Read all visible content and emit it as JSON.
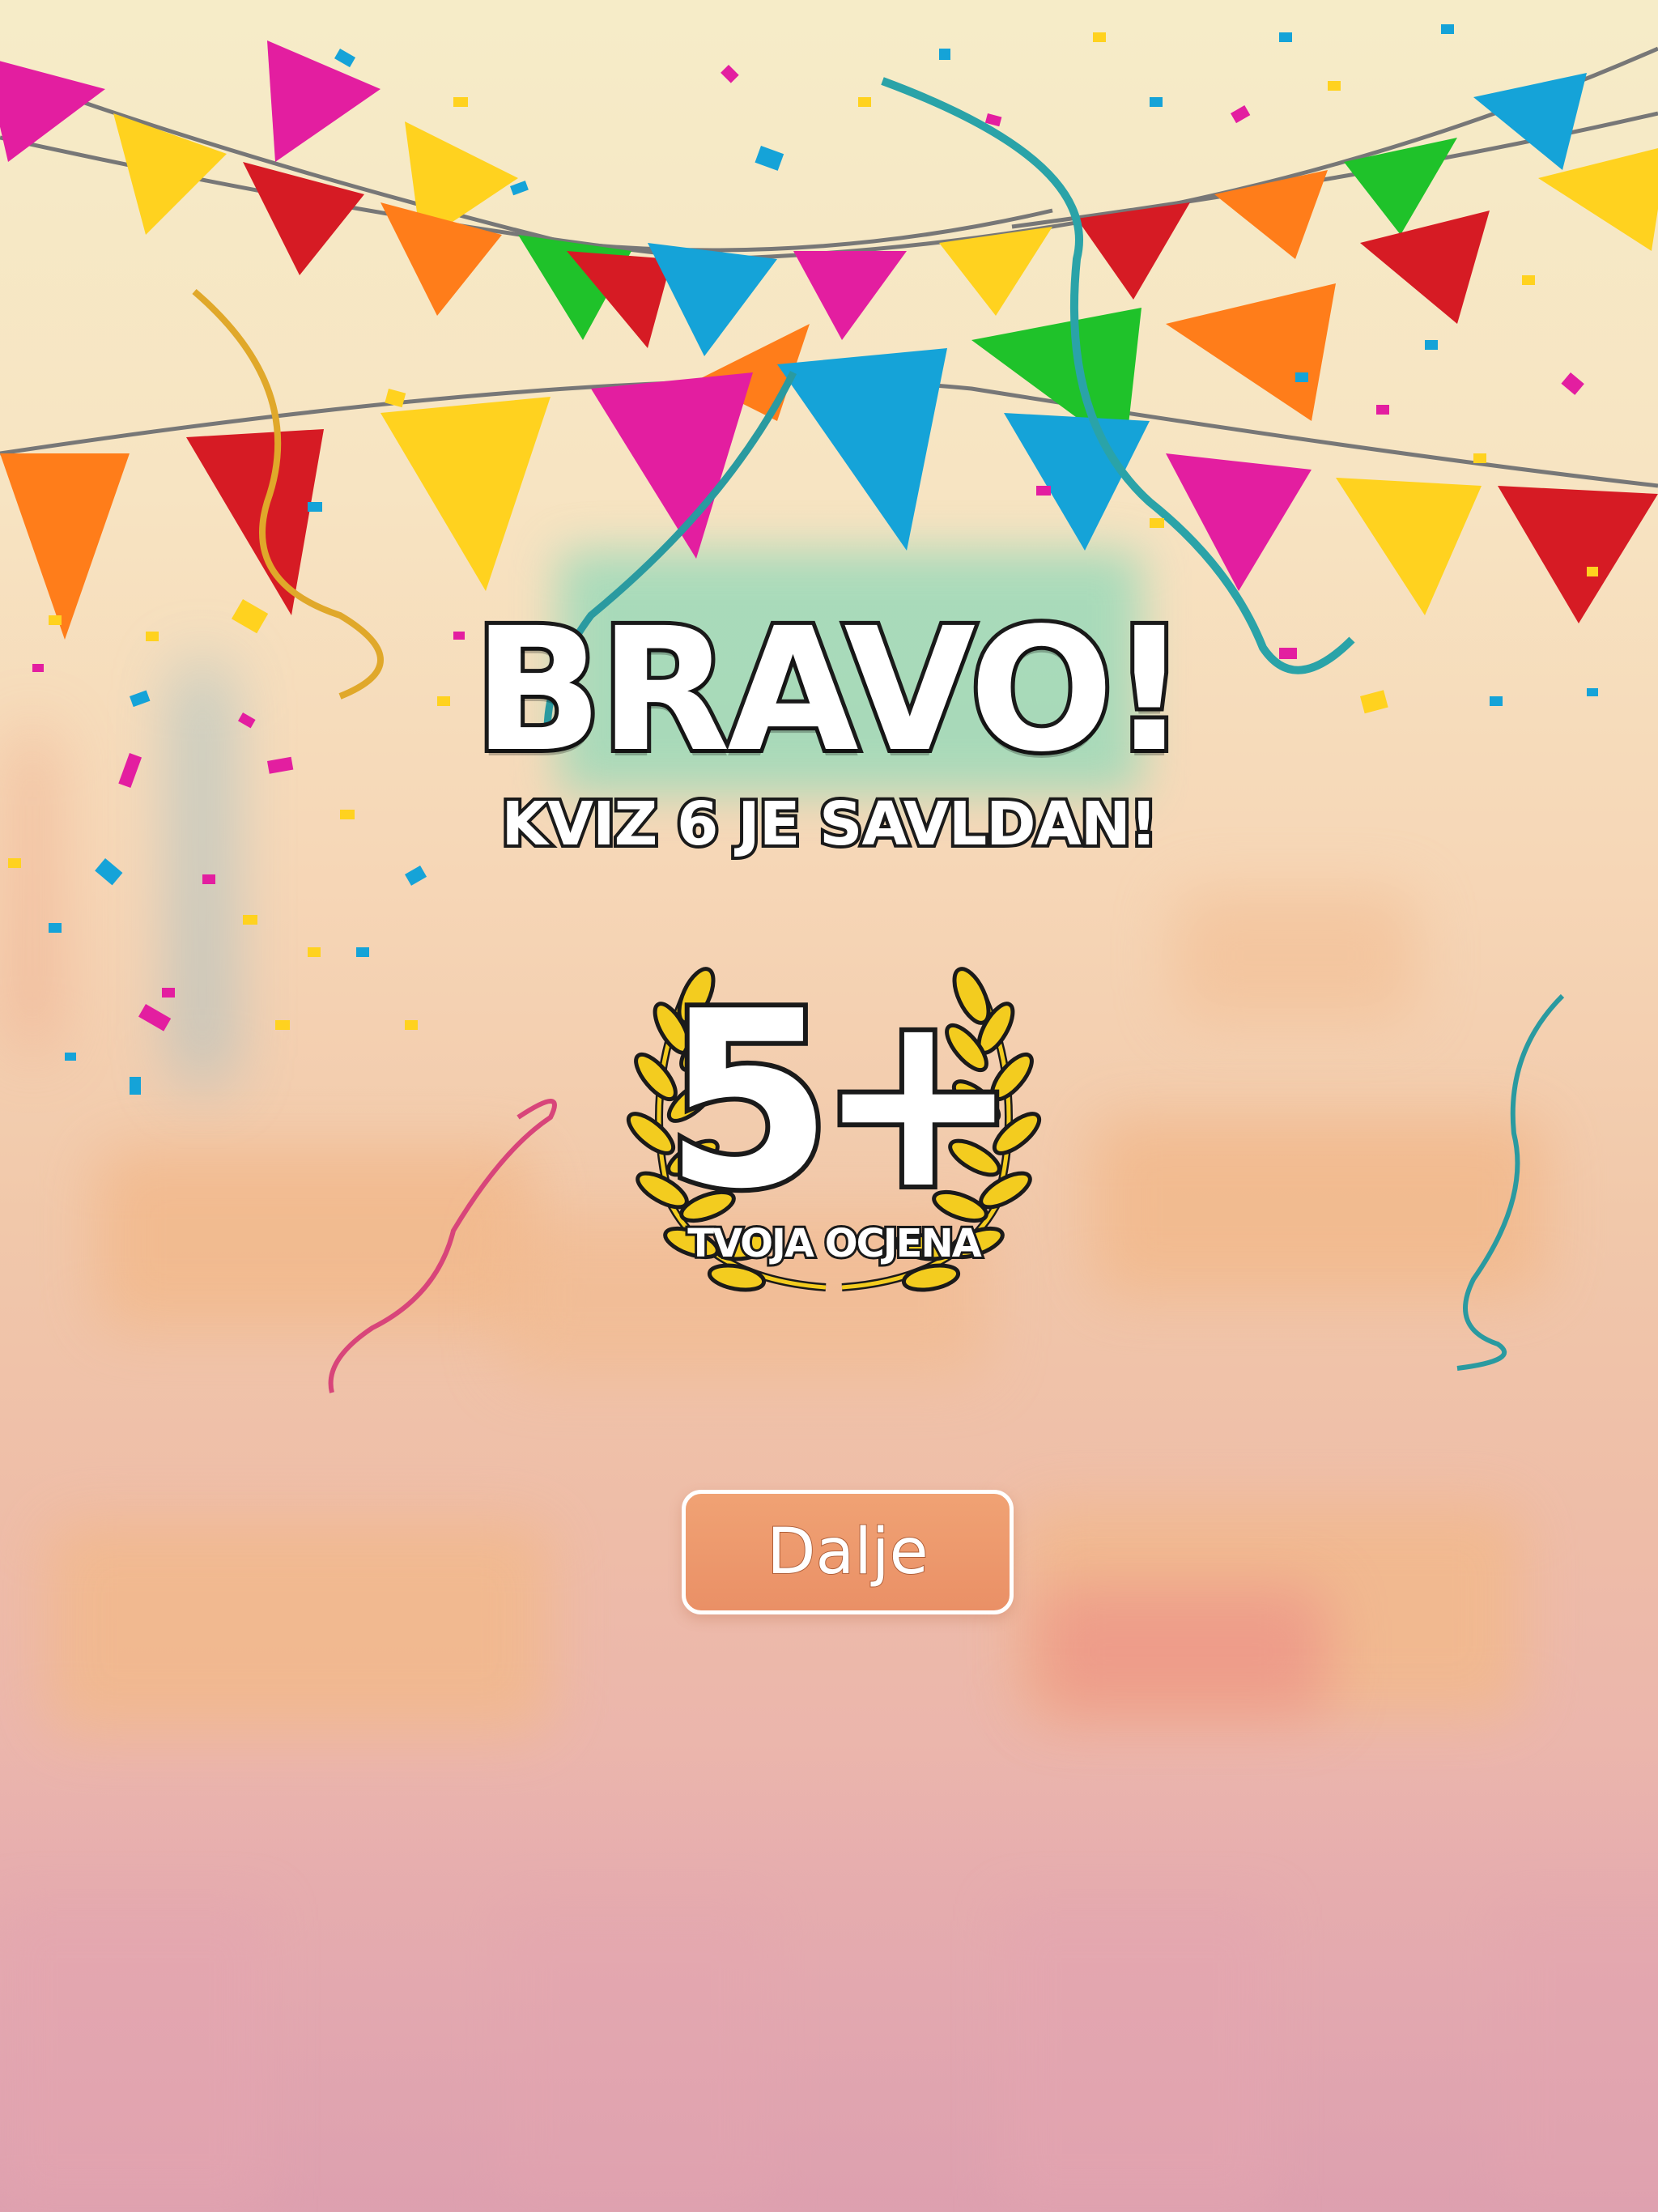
{
  "result_screen": {
    "title": "BRAVO!",
    "subtitle": "KVIZ 6 JE SAVLDAN!",
    "grade": "5+",
    "grade_label": "TVOJA OCJENA",
    "next_button_label": "Dalje"
  },
  "decorations": {
    "bunting_colors": [
      "#e31ea0",
      "#ffd21f",
      "#d61b24",
      "#ff7d1a",
      "#1fc22a",
      "#15a3d8"
    ],
    "laurel_color": "#f3cc1f",
    "button_color": "#ec9668"
  }
}
